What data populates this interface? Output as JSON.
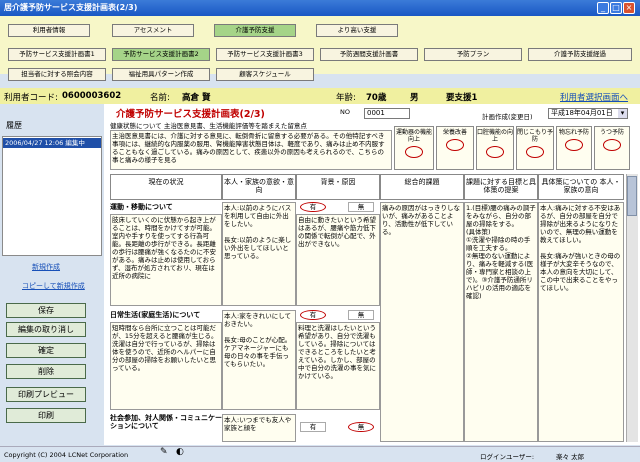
{
  "window": {
    "title": "居介護予防サービス支援計画表(2/3)",
    "min": "_",
    "max": "□",
    "close": "×"
  },
  "nav": {
    "row1": [
      "利用者情報",
      "アセスメント",
      "介護予防支援",
      "より高い支援"
    ],
    "row2": [
      "予防サービス支援計画書1",
      "予防サービス支援計画書2",
      "予防サービス支援計画書3",
      "予防週間支援計画書",
      "予防プラン",
      "介護予防支援経過"
    ],
    "row3": [
      "担当者に対する照会内容",
      "福祉用具パターン作成",
      "顧客スケジュール"
    ]
  },
  "info": {
    "code_label": "利用者コード:",
    "code": "0600003602",
    "name_label": "名前:",
    "name": "高倉 賢",
    "age_label": "年齢:",
    "age": "70歳",
    "sex": "男",
    "care": "要支援1",
    "user_select": "利用者選択画面へ"
  },
  "left": {
    "history_label": "履歴",
    "history_item": "2006/04/27 12:06 編集中",
    "new_link": "新規作成",
    "copy_link": "コピーして新規作成",
    "buttons": [
      "保存",
      "編集の取り消し",
      "確定",
      "削除",
      "印刷プレビュー",
      "印刷"
    ]
  },
  "page": {
    "title": "介護予防サービス支援計画表(2/3)",
    "subtitle": "健康状態について 主治医意見書、生活機能評価等を踏まえた留意点",
    "no_label": "NO",
    "no_value": "0001",
    "plan_label": "計画作成(変更日)",
    "plan_date": "平成18年04月01日",
    "health_text": "主治医意見書には、介護に対する意見に、転倒骨折に留意する必要がある。その他特記すべき事項には、継続的な内服薬の服用、腎機能障害状態目体は、軽度であり、痛みは止め不内服することもなく過ごしている。痛みの原因として、疾患以外の原因も考えられるので、こちらの事と痛みの様子を見る"
  },
  "toggles": [
    {
      "label": "運動器の機能向上"
    },
    {
      "label": "栄養改善"
    },
    {
      "label": "口腔機能の向上"
    },
    {
      "label": "閉じこもり予防"
    },
    {
      "label": "物忘れ予防"
    },
    {
      "label": "うつ予防"
    }
  ],
  "columns": [
    "現在の状況",
    "本人・家族の意欲・意向",
    "背景・原因",
    "総合的課題",
    "課題に対する目標と具体策の提案",
    "具体策についての 本人・家族の意向"
  ],
  "yes_label": "有",
  "no_label": "無",
  "sections": [
    {
      "title": "運動・移動について",
      "status": "肢床していくのに伏態から起き上がることは、時間をかけてすが可能。室内や手すりを使ってする行為可能。長距離の歩行ができる。長距離の歩行は腰痛が強くなるたのに不安がある。痛みは止めは使用しておらず、湿布が処方されておリ、現在は近所の病院に",
      "intention": "本人:以前のようにバスを利用して自由に外出をしたい。\n\n長女:以前のように楽しい外出をしてほしいと思っている。",
      "background": "自由に動きたいという希望はあるが、腰痛や筋力低下の関係で転倒が心配で、外出ができない。",
      "issue": "痛みの原因がはっきりしないが、痛みがあることより、活動性が低下している。",
      "proposal": "1.(目標)腰の痛みの調子をみながら、自分の部屋の掃除をする。\n(具体策)\n①洗濯や掃除の時の手順を工夫する。\n②無理のない運動により、痛みを軽減する(医師・専門家と相談の上で)。③介護予防通所リハビリの活用の適応を確認)",
      "plan_int": "本人:痛みに対する不安はあるが、自分の部屋を自分で掃除が出来るようになりたいので、無理の無い運動を教えてほしい。\n\n長女:痛みが強いときの母の様子が大変辛そうなので、本人の意向を大切にして、この中で出来ることをやってほしい。"
    },
    {
      "title": "日常生活(家庭生活)について",
      "status": "短時間なら台所に立つことは可能だが、15分を超えると腰痛が生じる。洗濯は自分で行っているが、掃除は体を使うので、近所のヘルパーに自分の部屋の掃除をお願いしたいと思っている。",
      "intention": "本人:家をきれいにしておきたい。\n\n長女:母のことが心配。ケアマネージャーにも母の日々の事を手伝ってもらいたい。",
      "background": "料理と洗濯はしたいという希望があり、自分で洗濯もしている。掃除についてはできるところをしたいと考えている。しかし、部屋の中で自分の洗濯の事を気にかけている。",
      "issue": "",
      "proposal": "",
      "plan_int": "本人:自分の身の回りのことは、マイペースで行いたいが、体調がいい時は、本当は家事をしたいと思っている。本当はヘルパーさんに少し手伝ってもらいたいが、自分でできないかとずっと考えていて、あとの事はしてもらいたいとおもっている"
    },
    {
      "title": "社会参加、対人関係・コミュニケーションについて",
      "status": "",
      "intention": "本人:いつまでも友人や家族と顔を",
      "background": "",
      "issue": "",
      "proposal": "",
      "plan_int": ""
    }
  ],
  "status": {
    "copyright": "Copyright (C) 2004 LCNet Corporation",
    "user_label": "ログインユーザー:",
    "user": "楽々 太郎"
  }
}
